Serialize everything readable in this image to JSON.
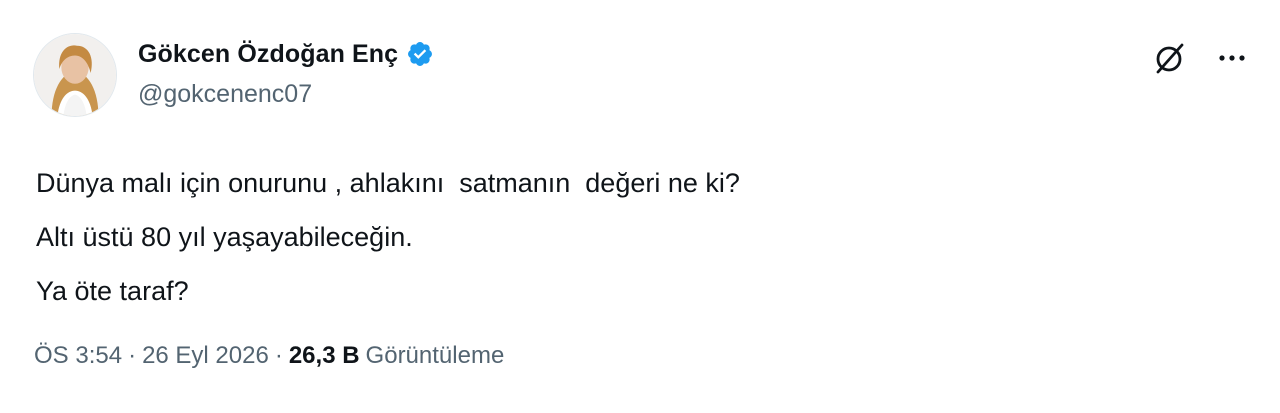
{
  "author": {
    "display_name": "Gökcen Özdoğan Enç",
    "handle": "@gokcenenc07",
    "verified_icon": "verified-badge-icon",
    "verified_color": "#1d9bf0"
  },
  "actions": {
    "grok_icon": "grok-icon",
    "more_icon": "more-options-icon"
  },
  "body": {
    "lines": [
      "Dünya malı için onurunu , ahlakını  satmanın  değeri ne ki?",
      "Altı üstü 80 yıl yaşayabileceğin.",
      "Ya öte taraf?"
    ]
  },
  "meta": {
    "time": "ÖS 3:54",
    "separator": "·",
    "date": "26 Eyl 2026",
    "views_count": "26,3 B",
    "views_label": "Görüntüleme"
  },
  "colors": {
    "text_primary": "#0f1419",
    "text_secondary": "#536471",
    "accent": "#1d9bf0"
  }
}
